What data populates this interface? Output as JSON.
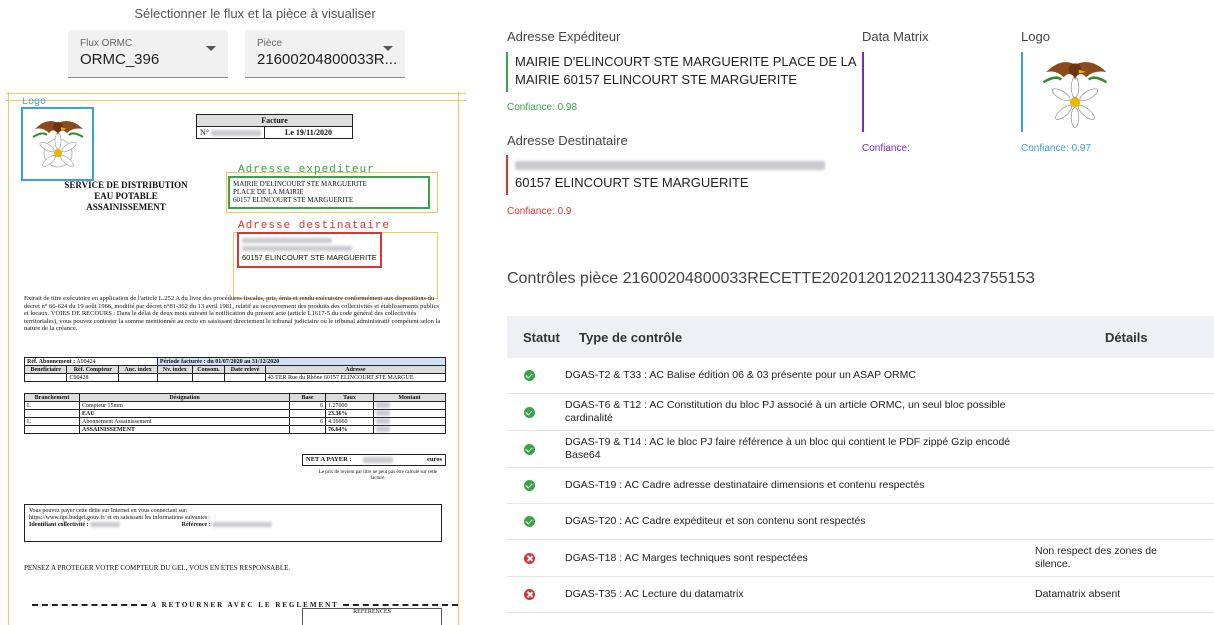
{
  "selection": {
    "title": "Sélectionner le flux et la pièce à visualiser",
    "flux": {
      "label": "Flux ORMC",
      "value": "ORMC_396"
    },
    "piece": {
      "label": "Pièce",
      "value": "21600204800033R..."
    }
  },
  "document": {
    "logo_label": "Logo",
    "service": [
      "SERVICE DE DISTRIBUTION",
      "EAU POTABLE",
      "ASSAINISSEMENT"
    ],
    "facture": {
      "title": "Facture",
      "num_label": "N°",
      "date": "Le 19/11/2020"
    },
    "expediteur_label": "Adresse expediteur",
    "expediteur_lines": [
      "MAIRIE D'ELINCOURT STE MARGUERITE",
      "PLACE DE LA MAIRIE",
      "60157 ELINCOURT STE MARGUERITE"
    ],
    "destinataire_label": "Adresse destinataire",
    "destinataire_city": "60157 ELINCOURT STE MARGUERITE",
    "legal": "Extrait de titre exécutoire en application de l'article L.252 A du livre des procédures fiscales, pris, émis et rendu exécutoire conformément aux dispositions du décret n° 66-624 du 19 août 1966, modifié par décret n°81-362 du 13 avril 1981, relatif au recouvrement des produits des collectivités et établissements publics et locaux. VOIES DE RECOURS : Dans le délai de deux mois suivant la notification du présent acte (article L1617-5 du code général des collectivités territoriales), vous pouvez contester la somme mentionnée au recto en saisissant directement le tribunal judiciaire ou le tribunal administratif compétent selon la nature de la créance.",
    "abonnement": {
      "label": "Réf. Abonnement :",
      "value": "A00424",
      "periode": "Période facturée : du 01/07/2020 au 31/12/2020"
    },
    "compteur_headers": [
      "Beneficiaire",
      "Réf. Compteur",
      "Anc. index",
      "Nv. index",
      "Consom.",
      "Date relevé",
      "Adresse"
    ],
    "compteur_row": {
      "ref": "C00428",
      "adresse": "43 TER Rue du Rhône 60157 ELINCOURT STE MARGUE"
    },
    "lines_headers": [
      "Branchement",
      "Désignation",
      "Base",
      "Taux",
      "Montant"
    ],
    "lines": [
      {
        "b": "L",
        "d": "Compteur 15mm",
        "base": "6",
        "taux": "1.27000"
      },
      {
        "b": "",
        "d": "EAU",
        "base": "",
        "taux": "23.36%"
      },
      {
        "b": "L",
        "d": "Abonnement Assainissement",
        "base": "6",
        "taux": "4.16660"
      },
      {
        "b": "",
        "d": "ASSAINISSEMENT",
        "base": "",
        "taux": "76.64%"
      }
    ],
    "net": {
      "label": "NET A PAYER :",
      "unit": "euros"
    },
    "note": "Le prix de revient par litre ne peut pas être calculé sur cette facture.",
    "pay_lines": [
      "Vous pouvez payer cette dette sur Internet en vous connectant sur:",
      "https://www.tipi.budget.gouv.fr/ et en saisissant les informations suivantes:"
    ],
    "pay_id_label": "Identifiant collectivité :",
    "pay_ref_label": "Référence :",
    "protect": "PENSEZ A PROTEGER VOTRE COMPTEUR DU GEL, VOUS EN ETES RESPONSABLE.",
    "retour": "A RETOURNER AVEC LE REGLEMENT",
    "references": "REFERENCES"
  },
  "fields": {
    "expediteur": {
      "title": "Adresse Expéditeur",
      "lines": [
        "MAIRIE D'ELINCOURT STE MARGUERITE PLACE DE LA",
        "MAIRIE 60157 ELINCOURT STE MARGUERITE"
      ],
      "confidence": "Confiance: 0.98",
      "color": "#3aa34a"
    },
    "destinataire": {
      "title": "Adresse Destinataire",
      "line": "60157 ELINCOURT STE MARGUERITE",
      "confidence": "Confiance: 0.9",
      "color": "#d33"
    },
    "datamatrix": {
      "title": "Data Matrix",
      "confidence": "Confiance:",
      "color": "#7b2cbf"
    },
    "logo": {
      "title": "Logo",
      "confidence": "Confiance: 0.97",
      "color": "#3aa0e0"
    }
  },
  "controls": {
    "title": "Contrôles pièce 21600204800033RECETTE20201201202113042375515З",
    "headers": {
      "statut": "Statut",
      "type": "Type de contrôle",
      "details": "Détails"
    },
    "rows": [
      {
        "status": "ok",
        "type": "DGAS-T2 & T33 : AC Balise édition 06 & 03 présente pour un ASAP ORMC",
        "details": ""
      },
      {
        "status": "ok",
        "type": "DGAS-T6 & T12 : AC Constitution du bloc PJ associé à un article ORMC, un seul bloc possible cardinalité",
        "details": ""
      },
      {
        "status": "ok",
        "type": "DGAS-T9 & T14 : AC le bloc PJ faire référence à un bloc qui contient le PDF zippé Gzip encodé Base64",
        "details": ""
      },
      {
        "status": "ok",
        "type": "DGAS-T19 : AC Cadre adresse destinataire dimensions et contenu respectés",
        "details": ""
      },
      {
        "status": "ok",
        "type": "DGAS-T20 : AC Cadre expéditeur et son contenu sont respectés",
        "details": ""
      },
      {
        "status": "ko",
        "type": "DGAS-T18 : AC Marges techniques sont respectées",
        "details": "Non respect des zones de silence."
      },
      {
        "status": "ko",
        "type": "DGAS-T35 : AC Lecture du datamatrix",
        "details": "Datamatrix absent"
      }
    ]
  }
}
